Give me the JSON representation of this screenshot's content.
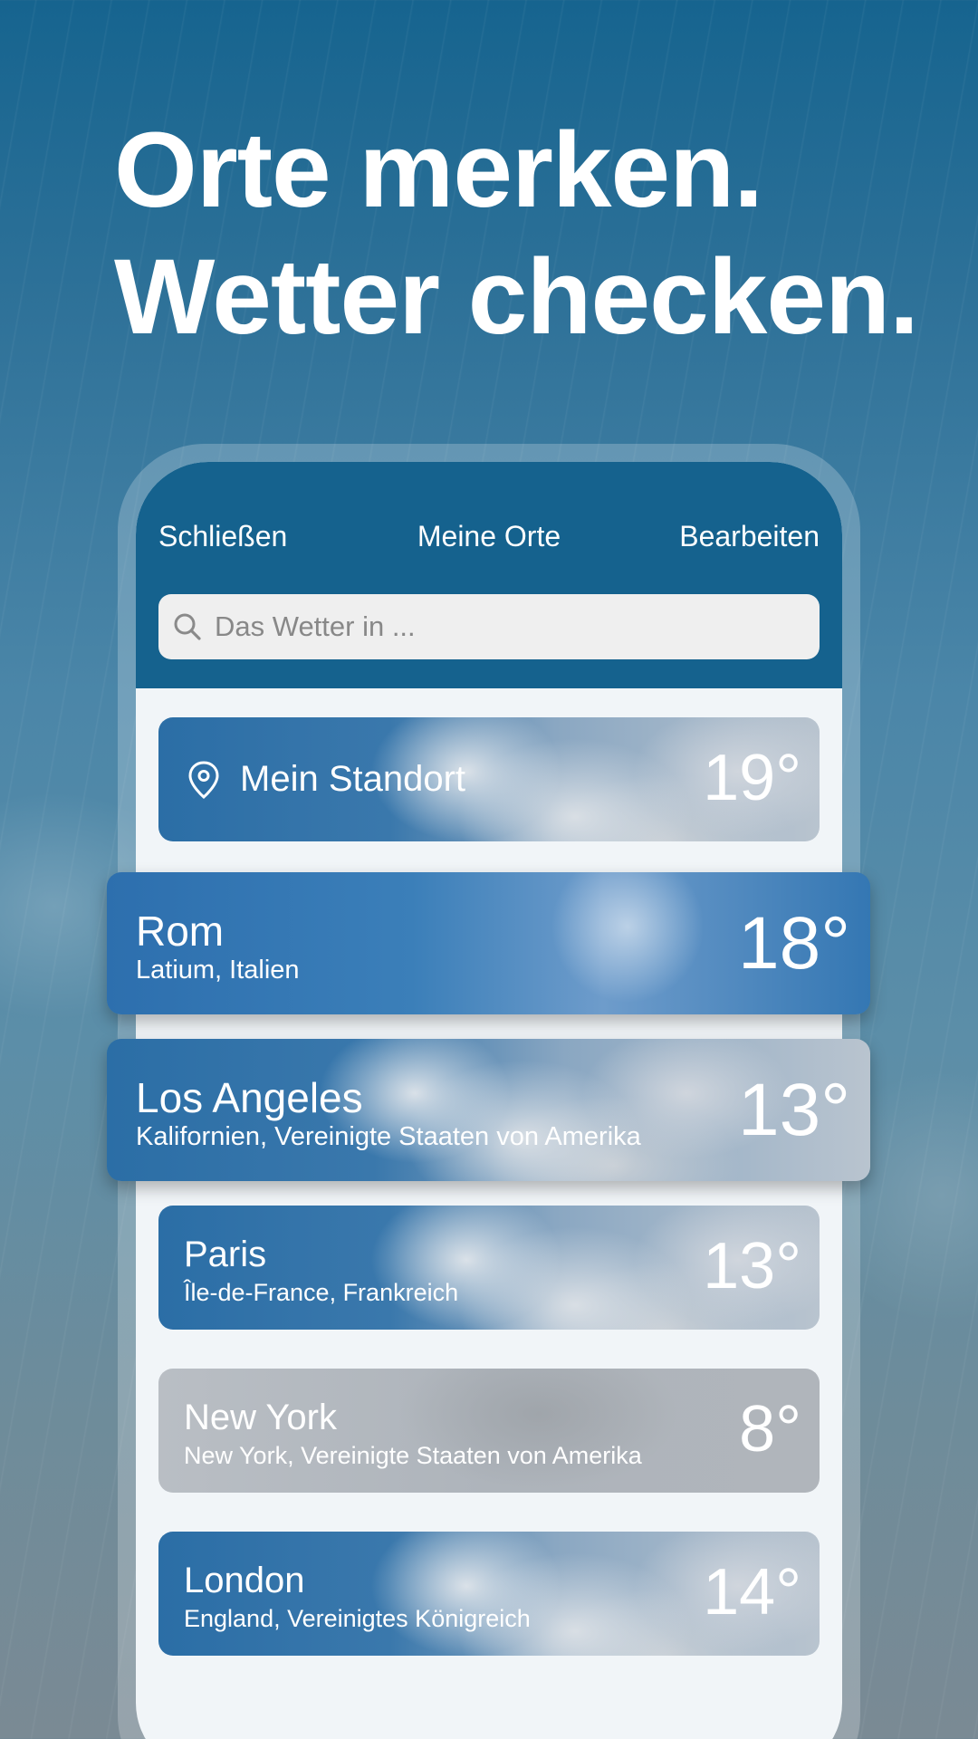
{
  "headline": {
    "line1": "Orte merken.",
    "line2": "Wetter checken."
  },
  "nav": {
    "close": "Schließen",
    "title": "Meine Orte",
    "edit": "Bearbeiten"
  },
  "search": {
    "placeholder": "Das Wetter in ..."
  },
  "current_location": {
    "label": "Mein Standort",
    "temp": "19°",
    "icon": "location-pin-icon"
  },
  "places": [
    {
      "name": "Rom",
      "region": "Latium, Italien",
      "temp": "18°"
    },
    {
      "name": "Los Angeles",
      "region": "Kalifornien, Vereinigte Staaten von Amerika",
      "temp": "13°"
    },
    {
      "name": "Paris",
      "region": "Île-de-France, Frankreich",
      "temp": "13°"
    },
    {
      "name": "New York",
      "region": "New York, Vereinigte Staaten von Amerika",
      "temp": "8°"
    },
    {
      "name": "London",
      "region": "England, Vereinigtes Königreich",
      "temp": "14°"
    }
  ],
  "colors": {
    "header": "#15628e",
    "list_bg": "#f1f5f8"
  }
}
